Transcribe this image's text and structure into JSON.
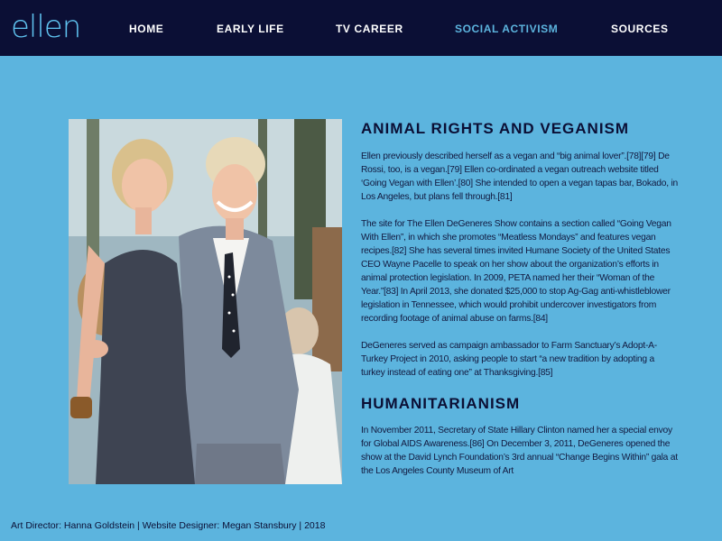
{
  "header": {
    "logo_text": "ellen",
    "nav": [
      {
        "label": "HOME",
        "active": false
      },
      {
        "label": "EARLY LIFE",
        "active": false
      },
      {
        "label": "TV CAREER",
        "active": false
      },
      {
        "label": "SOCIAL ACTIVISM",
        "active": true
      },
      {
        "label": "SOURCES",
        "active": false
      }
    ]
  },
  "colors": {
    "header_bg": "#0b0f35",
    "page_bg": "#5cb4de",
    "logo": "#5fc3f0",
    "active_nav": "#5cb4de",
    "text": "#12193f"
  },
  "main": {
    "sections": [
      {
        "heading": "ANIMAL RIGHTS AND VEGANISM",
        "paragraphs": [
          "Ellen previously described herself as a vegan and “big animal lover”.[78][79] De Rossi, too, is a vegan.[79] Ellen co-ordinated a vegan outreach website titled ‘Going Vegan with Ellen’.[80] She intended to open a vegan tapas bar, Bokado, in Los Angeles, but plans fell through.[81]",
          "The site for The Ellen DeGeneres Show contains a section called “Going Vegan With Ellen”, in which she promotes “Meatless Mondays” and features vegan recipes.[82] She has several times invited Humane Society of the United States CEO Wayne Pacelle to speak on her show about the organization’s efforts in animal protection legislation. In 2009, PETA named her their “Woman of the Year.”[83] In April 2013, she donated $25,000 to stop Ag-Gag anti-whistleblower legislation in Tennessee, which would prohibit undercover investigators from recording footage of animal abuse on farms.[84]",
          "DeGeneres served as campaign ambassador to Farm Sanctuary’s Adopt-A-Turkey Project in 2010, asking people to start “a new tradition by adopting a turkey instead of eating one” at Thanksgiving.[85]"
        ]
      },
      {
        "heading": "HUMANITARIANISM",
        "paragraphs": [
          "In November 2011, Secretary of State Hillary Clinton named her a special envoy for Global AIDS Awareness.[86] On December 3, 2011, DeGeneres opened the show at the David Lynch Foundation’s 3rd annual “Change Begins Within” gala at the Los Angeles County Museum of Art"
        ]
      }
    ]
  },
  "footer": {
    "credits": "Art Director: Hanna Goldstein | Website Designer: Megan Stansbury | 2018"
  }
}
